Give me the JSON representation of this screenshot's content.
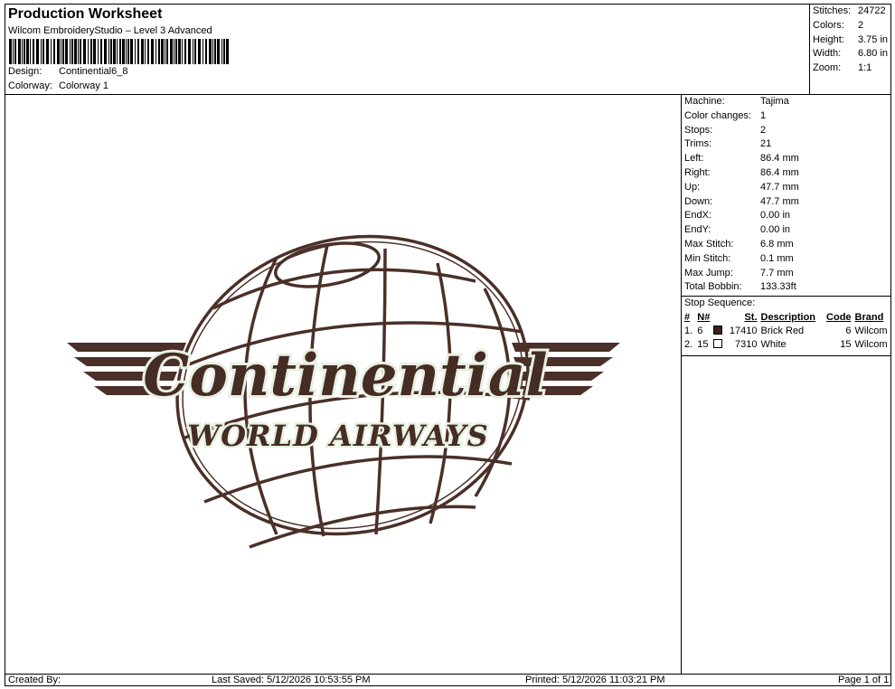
{
  "header": {
    "title": "Production Worksheet",
    "subtitle": "Wilcom EmbroideryStudio – Level 3 Advanced",
    "design_label": "Design:",
    "design_value": "Continential6_8",
    "colorway_label": "Colorway:",
    "colorway_value": "Colorway 1"
  },
  "stats": [
    {
      "label": "Stitches:",
      "value": "24722"
    },
    {
      "label": "Colors:",
      "value": "2"
    },
    {
      "label": "Height:",
      "value": "3.75 in"
    },
    {
      "label": "Width:",
      "value": "6.80 in"
    },
    {
      "label": "Zoom:",
      "value": "1:1"
    }
  ],
  "info": [
    {
      "label": "Machine:",
      "value": "Tajima"
    },
    {
      "label": "Color changes:",
      "value": "1"
    },
    {
      "label": "Stops:",
      "value": "2"
    },
    {
      "label": "Trims:",
      "value": "21"
    },
    {
      "label": "Left:",
      "value": "86.4 mm"
    },
    {
      "label": "Right:",
      "value": "86.4 mm"
    },
    {
      "label": "Up:",
      "value": "47.7 mm"
    },
    {
      "label": "Down:",
      "value": "47.7 mm"
    },
    {
      "label": "EndX:",
      "value": "0.00 in"
    },
    {
      "label": "EndY:",
      "value": "0.00 in"
    },
    {
      "label": "Max Stitch:",
      "value": "6.8 mm"
    },
    {
      "label": "Min Stitch:",
      "value": "0.1 mm"
    },
    {
      "label": "Max Jump:",
      "value": "7.7 mm"
    },
    {
      "label": "Total Bobbin:",
      "value": "133.33ft"
    }
  ],
  "stop_sequence": {
    "title": "Stop Sequence:",
    "headers": [
      "#",
      "N#",
      "St.",
      "Description",
      "Code",
      "Brand"
    ],
    "rows": [
      {
        "num": "1.",
        "n": "6",
        "color": "#3a1f1a",
        "st": "17410",
        "desc": "Brick Red",
        "code": "6",
        "brand": "Wilcom"
      },
      {
        "num": "2.",
        "n": "15",
        "color": "#ffffff",
        "st": "7310",
        "desc": "White",
        "code": "15",
        "brand": "Wilcom"
      }
    ]
  },
  "design_art": {
    "word_top": "Continential",
    "word_bottom": "WORLD AIRWAYS",
    "thread_dark": "#4a3028",
    "thread_light": "#e9f0e2"
  },
  "footer": {
    "created": "Created By:",
    "saved": "Last Saved: 5/12/2026 10:53:55 PM",
    "printed": "Printed: 5/12/2026 11:03:21 PM",
    "page": "Page 1 of 1"
  }
}
